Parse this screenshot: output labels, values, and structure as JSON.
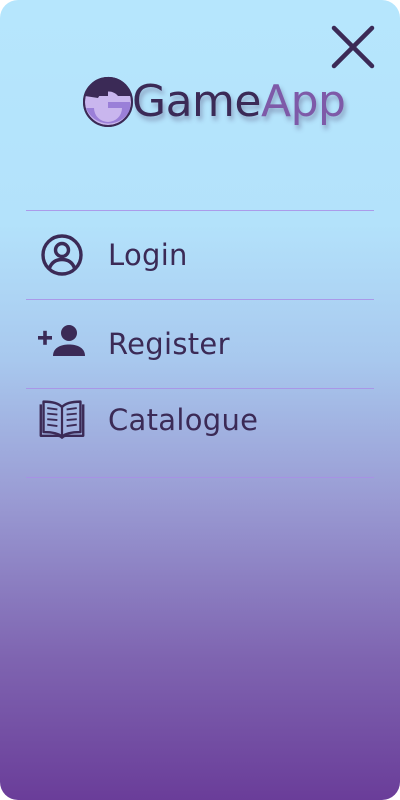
{
  "app": {
    "logo_text_part1": "Game",
    "logo_text_part2": "App"
  },
  "menu": {
    "items": [
      {
        "label": "Login",
        "icon": "user-circle-icon"
      },
      {
        "label": "Register",
        "icon": "add-user-icon"
      },
      {
        "label": "Catalogue",
        "icon": "open-book-icon"
      }
    ]
  },
  "colors": {
    "text": "#3b2a56",
    "accent": "#7e5aa8",
    "divider": "#a98ee6",
    "gradient_top": "#b6e6fd",
    "gradient_bottom": "#6a3d99"
  }
}
